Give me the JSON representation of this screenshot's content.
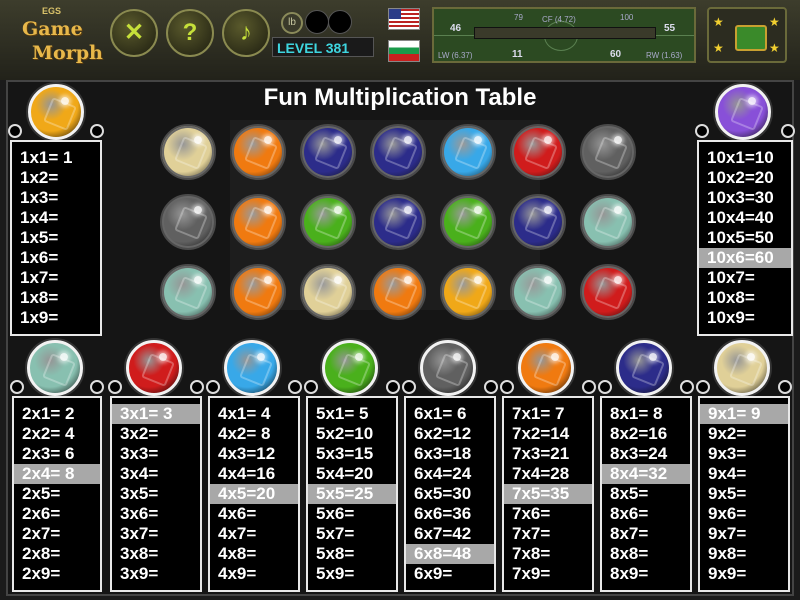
{
  "header": {
    "logo_small": "EGS",
    "logo_line1": "Game",
    "logo_line2": "Morph",
    "level_label": "LEVEL 381",
    "coin_label": "lb",
    "buttons": [
      {
        "name": "close-x-button",
        "glyph": "✕"
      },
      {
        "name": "help-button",
        "glyph": "?"
      },
      {
        "name": "music-button",
        "glyph": "♪"
      }
    ],
    "field": {
      "left_num": "46",
      "right_num": "55",
      "pos_top": "CF (4.72)",
      "pos_bl": "LW (6.37)",
      "pos_br": "RW (1.63)",
      "num_b1": "11",
      "num_b2": "60",
      "num_t1": "79",
      "num_t2": "100"
    }
  },
  "title": "Fun Multiplication Table",
  "colors": {
    "yellow": "#f0a818",
    "orange": "#f07a10",
    "navy": "#2c2c8a",
    "skyblue": "#38a8e8",
    "red": "#d01c1c",
    "gray": "#606060",
    "cream": "#e0d098",
    "green": "#4ab01c",
    "teal": "#88c0b0",
    "purple": "#8850d8"
  },
  "grid_rows": [
    [
      "cream",
      "orange",
      "navy",
      "navy",
      "skyblue",
      "red",
      "gray"
    ],
    [
      "gray",
      "orange",
      "green",
      "navy",
      "green",
      "navy",
      "teal"
    ],
    [
      "teal",
      "orange",
      "cream",
      "orange",
      "yellow",
      "teal",
      "red"
    ]
  ],
  "tables": [
    {
      "n": "1",
      "gem": "yellow",
      "highlight": -1,
      "rows": [
        "1x1= 1",
        "1x2=",
        "1x3=",
        "1x4=",
        "1x5=",
        "1x6=",
        "1x7=",
        "1x8=",
        "1x9="
      ]
    },
    {
      "n": "10",
      "gem": "purple",
      "highlight": 5,
      "rows": [
        "10x1=10",
        "10x2=20",
        "10x3=30",
        "10x4=40",
        "10x5=50",
        "10x6=60",
        "10x7=",
        "10x8=",
        "10x9="
      ]
    },
    {
      "n": "2",
      "gem": "teal",
      "highlight": 3,
      "rows": [
        "2x1= 2",
        "2x2= 4",
        "2x3= 6",
        "2x4= 8",
        "2x5=",
        "2x6=",
        "2x7=",
        "2x8=",
        "2x9="
      ]
    },
    {
      "n": "3",
      "gem": "red",
      "highlight": 0,
      "rows": [
        "3x1= 3",
        "3x2=",
        "3x3=",
        "3x4=",
        "3x5=",
        "3x6=",
        "3x7=",
        "3x8=",
        "3x9="
      ]
    },
    {
      "n": "4",
      "gem": "skyblue",
      "highlight": 4,
      "rows": [
        "4x1= 4",
        "4x2= 8",
        "4x3=12",
        "4x4=16",
        "4x5=20",
        "4x6=",
        "4x7=",
        "4x8=",
        "4x9="
      ]
    },
    {
      "n": "5",
      "gem": "green",
      "highlight": 4,
      "rows": [
        "5x1= 5",
        "5x2=10",
        "5x3=15",
        "5x4=20",
        "5x5=25",
        "5x6=",
        "5x7=",
        "5x8=",
        "5x9="
      ]
    },
    {
      "n": "6",
      "gem": "gray",
      "highlight": 7,
      "rows": [
        "6x1= 6",
        "6x2=12",
        "6x3=18",
        "6x4=24",
        "6x5=30",
        "6x6=36",
        "6x7=42",
        "6x8=48",
        "6x9="
      ]
    },
    {
      "n": "7",
      "gem": "orange",
      "highlight": 4,
      "rows": [
        "7x1= 7",
        "7x2=14",
        "7x3=21",
        "7x4=28",
        "7x5=35",
        "7x6=",
        "7x7=",
        "7x8=",
        "7x9="
      ]
    },
    {
      "n": "8",
      "gem": "navy",
      "highlight": 3,
      "rows": [
        "8x1= 8",
        "8x2=16",
        "8x3=24",
        "8x4=32",
        "8x5=",
        "8x6=",
        "8x7=",
        "8x8=",
        "8x9="
      ]
    },
    {
      "n": "9",
      "gem": "cream",
      "highlight": 0,
      "rows": [
        "9x1= 9",
        "9x2=",
        "9x3=",
        "9x4=",
        "9x5=",
        "9x6=",
        "9x7=",
        "9x8=",
        "9x9="
      ]
    }
  ]
}
